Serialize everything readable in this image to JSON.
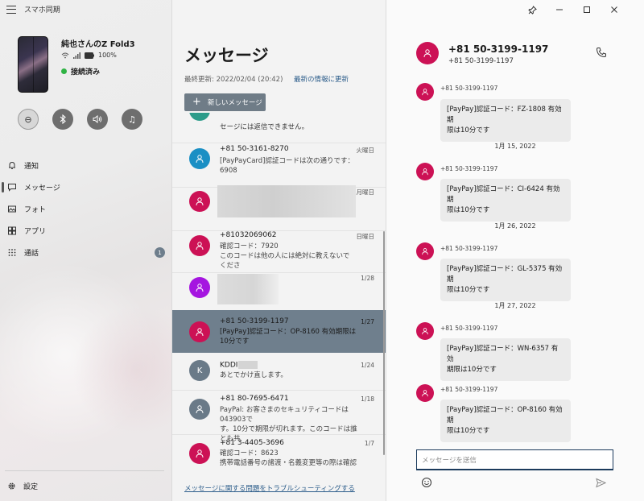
{
  "app": {
    "title": "スマホ同期"
  },
  "device": {
    "name": "純也さんのZ Fold3",
    "battery": "100%",
    "status": "接続済み"
  },
  "quick_actions": [
    {
      "name": "do-not-disturb",
      "icon": "⊖"
    },
    {
      "name": "bluetooth",
      "icon": "✱"
    },
    {
      "name": "volume",
      "icon": "🔊"
    },
    {
      "name": "music",
      "icon": "♫"
    }
  ],
  "nav": {
    "items": [
      {
        "label": "通知",
        "icon": "bell"
      },
      {
        "label": "メッセージ",
        "icon": "message"
      },
      {
        "label": "フォト",
        "icon": "photo"
      },
      {
        "label": "アプリ",
        "icon": "apps"
      },
      {
        "label": "通話",
        "icon": "grid",
        "badge": "1"
      }
    ],
    "settings": "設定"
  },
  "messages_panel": {
    "title": "メッセージ",
    "last_updated": "最終更新: 2022/02/04 (20:42)",
    "refresh": "最新の情報に更新",
    "new_message": "新しいメッセージ",
    "troubleshoot": "メッセージに関する問題をトラブルシューティングする",
    "partial_preview": "セージには返信できません。",
    "conversations": [
      {
        "name": "+81 50-3161-8270",
        "date": "火曜日",
        "preview": "[PayPayCard]認証コードは次の通りです：\n6908",
        "color": "#1a8fc4"
      },
      {
        "name": "",
        "date": "月曜日",
        "preview": "",
        "color": "#cc1155"
      },
      {
        "name": "+81032069062",
        "date": "日曜日",
        "preview": "確認コード：7920\nこのコードは他の人には絶対に教えないでくださ",
        "color": "#cc1155"
      },
      {
        "name": "",
        "date": "1/28",
        "preview": "",
        "color": "#a515e0"
      },
      {
        "name": "+81 50-3199-1197",
        "date": "1/27",
        "preview": "[PayPay]認証コード：OP-8160 有効期限は\n10分です",
        "color": "#cc1155"
      },
      {
        "name": "KDDI",
        "date": "1/24",
        "preview": "あとでかけ直します。",
        "color": "#6a7a88",
        "initial": "K"
      },
      {
        "name": "+81 80-7695-6471",
        "date": "1/18",
        "preview": "PayPal: お客さまのセキュリティコードは043903で\nす。10分で期限が切れます。このコードは誰とも共",
        "color": "#6a7a88"
      },
      {
        "name": "+81 3-4405-3696",
        "date": "1/7",
        "preview": "確認コード：8623\n携帯電話番号の諸渡・名義変更等の際は確認",
        "color": "#cc1155"
      }
    ]
  },
  "conversation": {
    "title": "+81 50-3199-1197",
    "subtitle": "+81 50-3199-1197",
    "sender": "+81 50-3199-1197",
    "messages": [
      {
        "text": "[PayPay]認証コード：FZ-1808 有効期\n限は10分です"
      },
      {
        "date": "1月 15, 2022"
      },
      {
        "text": "[PayPay]認証コード：CI-6424 有効期\n限は10分です"
      },
      {
        "date": "1月 26, 2022"
      },
      {
        "text": "[PayPay]認証コード：GL-5375 有効期\n限は10分です"
      },
      {
        "date": "1月 27, 2022"
      },
      {
        "text": "[PayPay]認証コード：WN-6357 有効\n期限は10分です"
      },
      {
        "text": "[PayPay]認証コード：OP-8160 有効期\n限は10分です"
      }
    ],
    "compose_placeholder": "メッセージを送信"
  }
}
